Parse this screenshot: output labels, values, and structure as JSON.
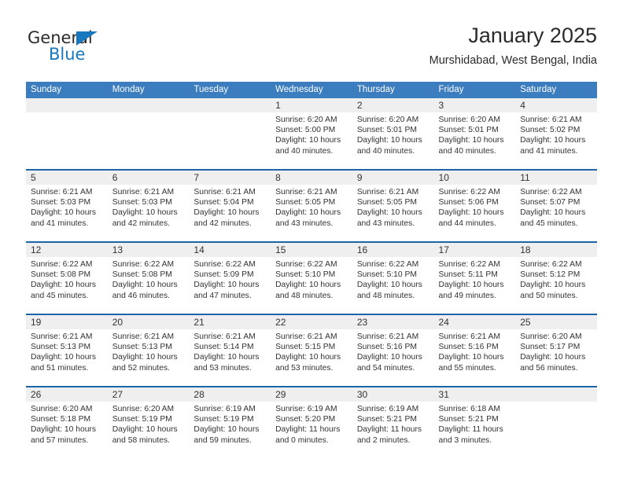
{
  "brand": {
    "name_part1": "General",
    "name_part2": "Blue",
    "accent_color": "#1878BE"
  },
  "header": {
    "title": "January 2025",
    "subtitle": "Murshidabad, West Bengal, India"
  },
  "theme": {
    "header_row_bg": "#3C7DBF",
    "week_separator": "#1D64A8",
    "day_band_bg": "#EFEFEF",
    "text_color": "#333333"
  },
  "weekdays": [
    "Sunday",
    "Monday",
    "Tuesday",
    "Wednesday",
    "Thursday",
    "Friday",
    "Saturday"
  ],
  "weeks": [
    [
      {
        "day": "",
        "lines": []
      },
      {
        "day": "",
        "lines": []
      },
      {
        "day": "",
        "lines": []
      },
      {
        "day": "1",
        "lines": [
          "Sunrise: 6:20 AM",
          "Sunset: 5:00 PM",
          "Daylight: 10 hours",
          "and 40 minutes."
        ]
      },
      {
        "day": "2",
        "lines": [
          "Sunrise: 6:20 AM",
          "Sunset: 5:01 PM",
          "Daylight: 10 hours",
          "and 40 minutes."
        ]
      },
      {
        "day": "3",
        "lines": [
          "Sunrise: 6:20 AM",
          "Sunset: 5:01 PM",
          "Daylight: 10 hours",
          "and 40 minutes."
        ]
      },
      {
        "day": "4",
        "lines": [
          "Sunrise: 6:21 AM",
          "Sunset: 5:02 PM",
          "Daylight: 10 hours",
          "and 41 minutes."
        ]
      }
    ],
    [
      {
        "day": "5",
        "lines": [
          "Sunrise: 6:21 AM",
          "Sunset: 5:03 PM",
          "Daylight: 10 hours",
          "and 41 minutes."
        ]
      },
      {
        "day": "6",
        "lines": [
          "Sunrise: 6:21 AM",
          "Sunset: 5:03 PM",
          "Daylight: 10 hours",
          "and 42 minutes."
        ]
      },
      {
        "day": "7",
        "lines": [
          "Sunrise: 6:21 AM",
          "Sunset: 5:04 PM",
          "Daylight: 10 hours",
          "and 42 minutes."
        ]
      },
      {
        "day": "8",
        "lines": [
          "Sunrise: 6:21 AM",
          "Sunset: 5:05 PM",
          "Daylight: 10 hours",
          "and 43 minutes."
        ]
      },
      {
        "day": "9",
        "lines": [
          "Sunrise: 6:21 AM",
          "Sunset: 5:05 PM",
          "Daylight: 10 hours",
          "and 43 minutes."
        ]
      },
      {
        "day": "10",
        "lines": [
          "Sunrise: 6:22 AM",
          "Sunset: 5:06 PM",
          "Daylight: 10 hours",
          "and 44 minutes."
        ]
      },
      {
        "day": "11",
        "lines": [
          "Sunrise: 6:22 AM",
          "Sunset: 5:07 PM",
          "Daylight: 10 hours",
          "and 45 minutes."
        ]
      }
    ],
    [
      {
        "day": "12",
        "lines": [
          "Sunrise: 6:22 AM",
          "Sunset: 5:08 PM",
          "Daylight: 10 hours",
          "and 45 minutes."
        ]
      },
      {
        "day": "13",
        "lines": [
          "Sunrise: 6:22 AM",
          "Sunset: 5:08 PM",
          "Daylight: 10 hours",
          "and 46 minutes."
        ]
      },
      {
        "day": "14",
        "lines": [
          "Sunrise: 6:22 AM",
          "Sunset: 5:09 PM",
          "Daylight: 10 hours",
          "and 47 minutes."
        ]
      },
      {
        "day": "15",
        "lines": [
          "Sunrise: 6:22 AM",
          "Sunset: 5:10 PM",
          "Daylight: 10 hours",
          "and 48 minutes."
        ]
      },
      {
        "day": "16",
        "lines": [
          "Sunrise: 6:22 AM",
          "Sunset: 5:10 PM",
          "Daylight: 10 hours",
          "and 48 minutes."
        ]
      },
      {
        "day": "17",
        "lines": [
          "Sunrise: 6:22 AM",
          "Sunset: 5:11 PM",
          "Daylight: 10 hours",
          "and 49 minutes."
        ]
      },
      {
        "day": "18",
        "lines": [
          "Sunrise: 6:22 AM",
          "Sunset: 5:12 PM",
          "Daylight: 10 hours",
          "and 50 minutes."
        ]
      }
    ],
    [
      {
        "day": "19",
        "lines": [
          "Sunrise: 6:21 AM",
          "Sunset: 5:13 PM",
          "Daylight: 10 hours",
          "and 51 minutes."
        ]
      },
      {
        "day": "20",
        "lines": [
          "Sunrise: 6:21 AM",
          "Sunset: 5:13 PM",
          "Daylight: 10 hours",
          "and 52 minutes."
        ]
      },
      {
        "day": "21",
        "lines": [
          "Sunrise: 6:21 AM",
          "Sunset: 5:14 PM",
          "Daylight: 10 hours",
          "and 53 minutes."
        ]
      },
      {
        "day": "22",
        "lines": [
          "Sunrise: 6:21 AM",
          "Sunset: 5:15 PM",
          "Daylight: 10 hours",
          "and 53 minutes."
        ]
      },
      {
        "day": "23",
        "lines": [
          "Sunrise: 6:21 AM",
          "Sunset: 5:16 PM",
          "Daylight: 10 hours",
          "and 54 minutes."
        ]
      },
      {
        "day": "24",
        "lines": [
          "Sunrise: 6:21 AM",
          "Sunset: 5:16 PM",
          "Daylight: 10 hours",
          "and 55 minutes."
        ]
      },
      {
        "day": "25",
        "lines": [
          "Sunrise: 6:20 AM",
          "Sunset: 5:17 PM",
          "Daylight: 10 hours",
          "and 56 minutes."
        ]
      }
    ],
    [
      {
        "day": "26",
        "lines": [
          "Sunrise: 6:20 AM",
          "Sunset: 5:18 PM",
          "Daylight: 10 hours",
          "and 57 minutes."
        ]
      },
      {
        "day": "27",
        "lines": [
          "Sunrise: 6:20 AM",
          "Sunset: 5:19 PM",
          "Daylight: 10 hours",
          "and 58 minutes."
        ]
      },
      {
        "day": "28",
        "lines": [
          "Sunrise: 6:19 AM",
          "Sunset: 5:19 PM",
          "Daylight: 10 hours",
          "and 59 minutes."
        ]
      },
      {
        "day": "29",
        "lines": [
          "Sunrise: 6:19 AM",
          "Sunset: 5:20 PM",
          "Daylight: 11 hours",
          "and 0 minutes."
        ]
      },
      {
        "day": "30",
        "lines": [
          "Sunrise: 6:19 AM",
          "Sunset: 5:21 PM",
          "Daylight: 11 hours",
          "and 2 minutes."
        ]
      },
      {
        "day": "31",
        "lines": [
          "Sunrise: 6:18 AM",
          "Sunset: 5:21 PM",
          "Daylight: 11 hours",
          "and 3 minutes."
        ]
      },
      {
        "day": "",
        "lines": []
      }
    ]
  ]
}
